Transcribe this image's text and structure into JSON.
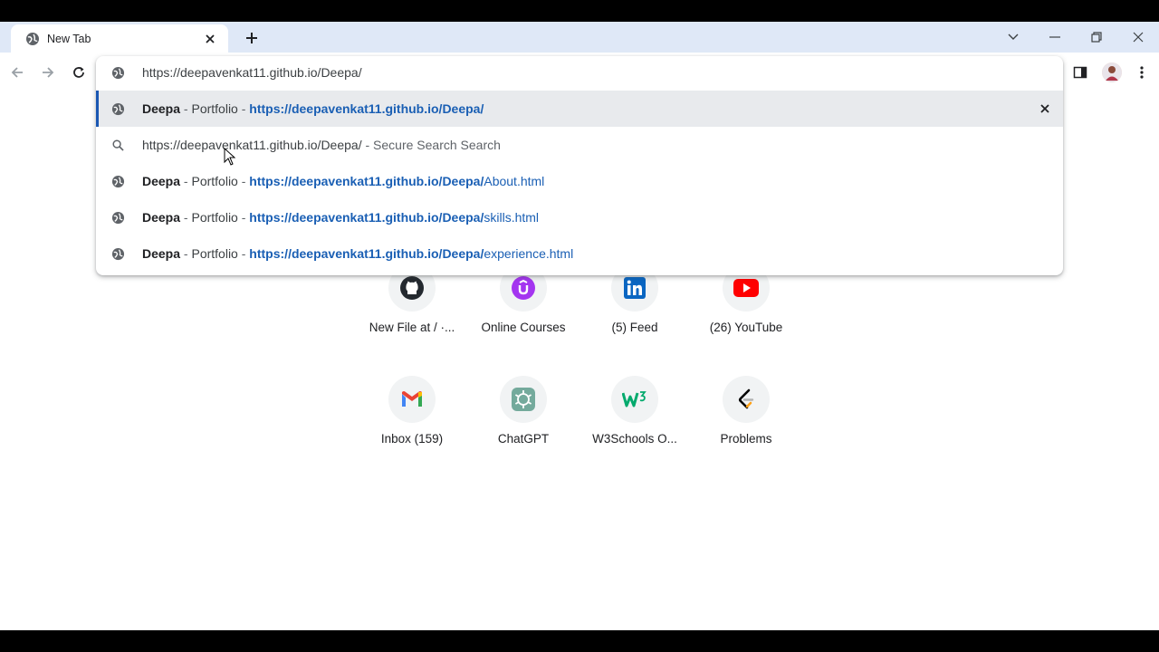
{
  "tab": {
    "title": "New Tab",
    "icon": "globe-icon"
  },
  "toolbar": {
    "back_icon": "back-arrow-icon",
    "forward_icon": "forward-arrow-icon",
    "reload_icon": "reload-icon"
  },
  "omnibox": {
    "input_value": "https://deepavenkat11.github.io/Deepa/",
    "suggestions": [
      {
        "title": "Deepa",
        "sep": " - ",
        "subtitle": "Portfolio",
        "sep2": " - ",
        "url_bold": "https://deepavenkat11.github.io/Deepa/",
        "url_rest": ""
      },
      {
        "query": "https://deepavenkat11.github.io/Deepa/",
        "sep": " - ",
        "engine": "Secure Search Search"
      },
      {
        "title": "Deepa",
        "sep": " - ",
        "subtitle": "Portfolio",
        "sep2": " - ",
        "url_bold": "https://deepavenkat11.github.io/Deepa/",
        "url_rest": "About.html"
      },
      {
        "title": "Deepa",
        "sep": " - ",
        "subtitle": "Portfolio",
        "sep2": " - ",
        "url_bold": "https://deepavenkat11.github.io/Deepa/",
        "url_rest": "skills.html"
      },
      {
        "title": "Deepa",
        "sep": " - ",
        "subtitle": "Portfolio",
        "sep2": " - ",
        "url_bold": "https://deepavenkat11.github.io/Deepa/",
        "url_rest": "experience.html"
      }
    ]
  },
  "shortcuts": [
    {
      "label": "New File at / ·...",
      "icon": "github-icon"
    },
    {
      "label": "Online Courses",
      "icon": "udemy-icon"
    },
    {
      "label": "(5) Feed",
      "icon": "linkedin-icon"
    },
    {
      "label": "(26) YouTube",
      "icon": "youtube-icon"
    },
    {
      "label": "Inbox (159)",
      "icon": "gmail-icon"
    },
    {
      "label": "ChatGPT",
      "icon": "chatgpt-icon"
    },
    {
      "label": "W3Schools O...",
      "icon": "w3schools-icon"
    },
    {
      "label": "Problems",
      "icon": "leetcode-icon"
    }
  ],
  "colors": {
    "tabstrip": "#dfe8f7",
    "selected_row": "#e8eaed",
    "link_blue": "#1a5fb4",
    "accent_bar": "#1a57b3"
  }
}
